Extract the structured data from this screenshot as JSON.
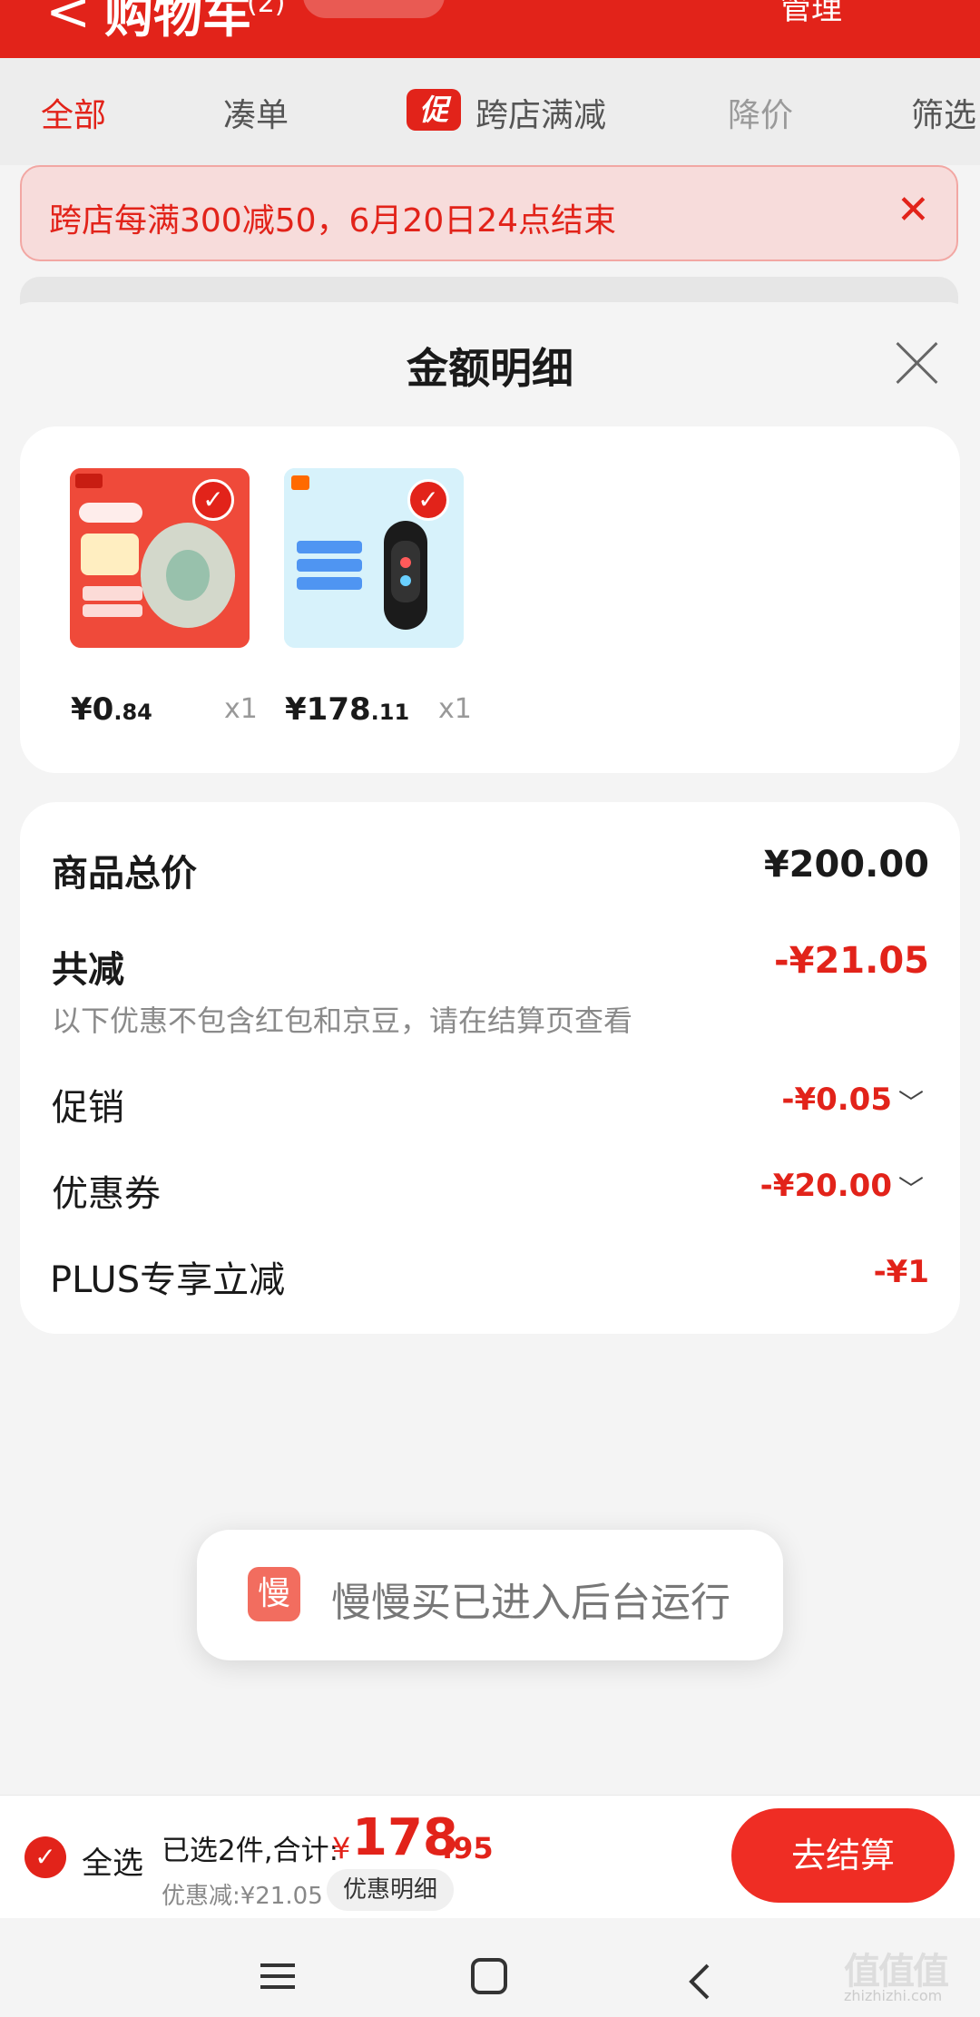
{
  "header": {
    "back": "<",
    "title": "购物车",
    "count": "(2)",
    "manage": "管理",
    "more": "⋯"
  },
  "tabs": [
    {
      "label": "全部"
    },
    {
      "label": "凑单"
    },
    {
      "badge": "促",
      "label": "跨店满减"
    },
    {
      "label": "降价"
    },
    {
      "label": "筛选"
    }
  ],
  "promo_banner": {
    "text": "跨店每满300减50，6月20日24点结束",
    "close": "✕"
  },
  "sheet": {
    "title": "金额明细"
  },
  "products": [
    {
      "price_int": "¥0",
      "price_dec": ".84",
      "qty": "x1",
      "check": "✓"
    },
    {
      "price_int": "¥178",
      "price_dec": ".11",
      "qty": "x1",
      "check": "✓"
    }
  ],
  "details": {
    "total_label": "商品总价",
    "total_value": "¥200.00",
    "reduce_label": "共减",
    "reduce_value": "-¥21.05",
    "note": "以下优惠不包含红包和京豆，请在结算页查看",
    "promo_label": "促销",
    "promo_value": "-¥0.05",
    "coupon_label": "优惠券",
    "coupon_value": "-¥20.00",
    "plus_label": "PLUS专享立减",
    "plus_value": "-¥1",
    "chevron": "﹀"
  },
  "toast": {
    "icon": "慢",
    "message": "慢慢买已进入后台运行"
  },
  "bottom": {
    "check": "✓",
    "select_all": "全选",
    "selected": "已选2件,合计:",
    "currency": "¥",
    "total_int": "178",
    "total_dec": ".95",
    "discount": "优惠减:¥21.05",
    "detail_btn": "优惠明细",
    "checkout": "去结算"
  },
  "watermark": {
    "text": "值值值",
    "domain": "zhizhizhi.com"
  },
  "colors": {
    "accent": "#e2231a",
    "button": "#ef2d24"
  }
}
